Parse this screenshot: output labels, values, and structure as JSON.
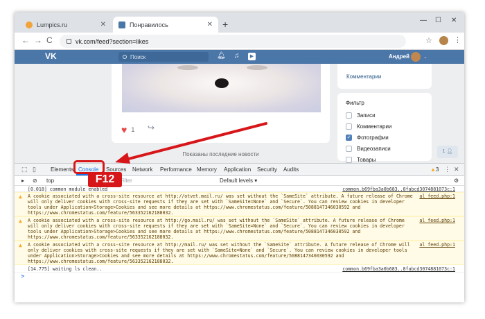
{
  "browser": {
    "tabs": [
      {
        "label": "Lumpics.ru",
        "color": "#f2a33a"
      },
      {
        "label": "Понравилось",
        "color": "#4a76a8"
      }
    ],
    "new_tab": "+",
    "minimize": "—",
    "maximize": "☐",
    "close": "✕",
    "url": "vk.com/feed?section=likes",
    "nav": {
      "back": "←",
      "forward": "→",
      "reload": "C"
    }
  },
  "vk": {
    "logo": "VK",
    "search_placeholder": "Поиск",
    "user_name": "Андрей",
    "likes_count": "1",
    "shown_text": "Показаны последние новости",
    "side_link": "Комментарии",
    "filter": {
      "title": "Фильтр",
      "options": [
        {
          "label": "Записи",
          "checked": false
        },
        {
          "label": "Комментарии",
          "checked": false
        },
        {
          "label": "Фотографии",
          "checked": true
        },
        {
          "label": "Видеозаписи",
          "checked": false
        },
        {
          "label": "Товары",
          "checked": false
        }
      ]
    },
    "counter": "1"
  },
  "devtools": {
    "tabs": [
      "Elements",
      "Console",
      "Sources",
      "Network",
      "Performance",
      "Memory",
      "Application",
      "Security",
      "Audits"
    ],
    "active_tab": "Console",
    "warning_count": "3",
    "context": "top",
    "filter_placeholder": "Filter",
    "levels": "Default levels ▾",
    "log": [
      {
        "type": "info",
        "text": "[0.018]  common module enabled",
        "source": "common.b69fba3a0b683..8fabcd3074881073c:1"
      },
      {
        "type": "warn",
        "text": "A cookie associated with a cross-site resource at http://otvet.mail.ru/ was set without the `SameSite` attribute. A future release of Chrome will only deliver cookies with cross-site requests if they are set with `SameSite=None` and `Secure`. You can review cookies in developer tools under Application>Storage>Cookies and see more details at https://www.chromestatus.com/feature/5088147346030592 and https://www.chromestatus.com/feature/563352162188032.",
        "source": "al_feed.php:1"
      },
      {
        "type": "warn",
        "text": "A cookie associated with a cross-site resource at http://go.mail.ru/ was set without the `SameSite` attribute. A future release of Chrome will only deliver cookies with cross-site requests if they are set with `SameSite=None` and `Secure`. You can review cookies in developer tools under Application>Storage>Cookies and see more details at https://www.chromestatus.com/feature/5088147346030592 and https://www.chromestatus.com/feature/563352162188032.",
        "source": "al_feed.php:1"
      },
      {
        "type": "warn",
        "text": "A cookie associated with a cross-site resource at http://mail.ru/ was set without the `SameSite` attribute. A future release of Chrome will only deliver cookies with cross-site requests if they are set with `SameSite=None` and `Secure`. You can review cookies in developer tools under Application>Storage>Cookies and see more details at https://www.chromestatus.com/feature/5088147346030592 and https://www.chromestatus.com/feature/563352162188032.",
        "source": "al_feed.php:1"
      },
      {
        "type": "info",
        "text": "[14.775]  waiting ls clean..",
        "source": "common.b69fba3a0b683..8fabcd3074881073c:1"
      }
    ],
    "prompt": ">"
  },
  "annotation": {
    "label": "F12",
    "color": "#d7161a"
  }
}
